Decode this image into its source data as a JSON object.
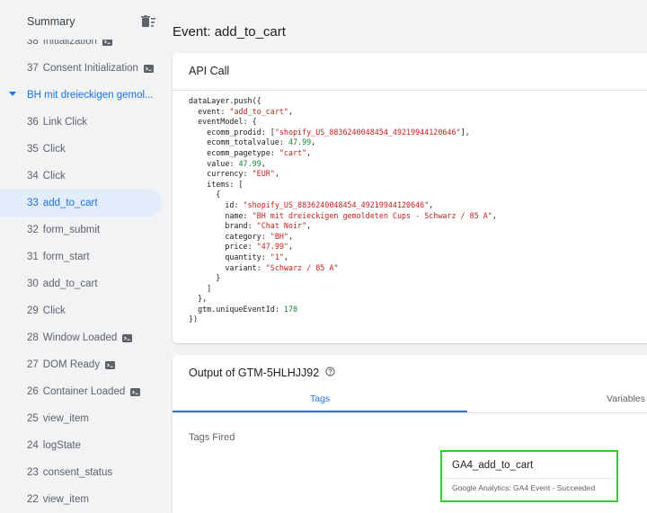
{
  "sidebar": {
    "title": "Summary",
    "items": [
      {
        "num": "38",
        "label": "Initialization",
        "icon": true
      },
      {
        "num": "37",
        "label": "Consent Initialization",
        "icon": true
      },
      {
        "label": "BH mit dreieckigen gemol...",
        "group": true
      },
      {
        "num": "36",
        "label": "Link Click"
      },
      {
        "num": "35",
        "label": "Click"
      },
      {
        "num": "34",
        "label": "Click"
      },
      {
        "num": "33",
        "label": "add_to_cart",
        "selected": true
      },
      {
        "num": "32",
        "label": "form_submit"
      },
      {
        "num": "31",
        "label": "form_start"
      },
      {
        "num": "30",
        "label": "add_to_cart"
      },
      {
        "num": "29",
        "label": "Click"
      },
      {
        "num": "28",
        "label": "Window Loaded",
        "icon": true
      },
      {
        "num": "27",
        "label": "DOM Ready",
        "icon": true
      },
      {
        "num": "26",
        "label": "Container Loaded",
        "icon": true
      },
      {
        "num": "25",
        "label": "view_item"
      },
      {
        "num": "24",
        "label": "logState"
      },
      {
        "num": "23",
        "label": "consent_status"
      },
      {
        "num": "22",
        "label": "view_item"
      }
    ]
  },
  "main": {
    "title": "Event: add_to_cart",
    "api_call": {
      "title": "API Call",
      "code": {
        "open": "dataLayer.push({",
        "event_key": "event",
        "event_val": "\"add_to_cart\"",
        "model_key": "eventModel",
        "prodid_key": "ecomm_prodid",
        "prodid_val": "\"shopify_US_8836240048454_49219944120646\"",
        "totalvalue_key": "ecomm_totalvalue",
        "totalvalue_val": "47.99",
        "pagetype_key": "ecomm_pagetype",
        "pagetype_val": "\"cart\"",
        "value_key": "value",
        "value_val": "47.99",
        "currency_key": "currency",
        "currency_val": "\"EUR\"",
        "items_key": "items",
        "id_key": "id",
        "id_val": "\"shopify_US_8836240048454_49219944120646\"",
        "name_key": "name",
        "name_val": "\"BH mit dreieckigen gemoldeten Cups - Schwarz / 85 A\"",
        "brand_key": "brand",
        "brand_val": "\"Chat Noir\"",
        "category_key": "category",
        "category_val": "\"BH\"",
        "price_key": "price",
        "price_val": "\"47.99\"",
        "quantity_key": "quantity",
        "quantity_val": "\"1\"",
        "variant_key": "variant",
        "variant_val": "\"Schwarz / 85 A\"",
        "uid_key": "gtm.uniqueEventId",
        "uid_val": "170",
        "close": "})"
      }
    },
    "output": {
      "title": "Output of GTM-5HLHJJ92",
      "tabs": [
        "Tags",
        "Variables"
      ],
      "tags_fired_label": "Tags Fired",
      "tag": {
        "name": "GA4_add_to_cart",
        "status": "Google Analytics: GA4 Event - Succeeded"
      }
    }
  },
  "colors": {
    "accent": "#1a73e8",
    "selected_bg": "#e3ecfa",
    "highlight": "#22d622",
    "string": "#c5221f",
    "number": "#188038"
  },
  "icons": {
    "clear": "delete-sweep-icon",
    "event": "console-event-icon",
    "help": "help-circle-icon",
    "group_toggle": "caret-down-icon"
  }
}
